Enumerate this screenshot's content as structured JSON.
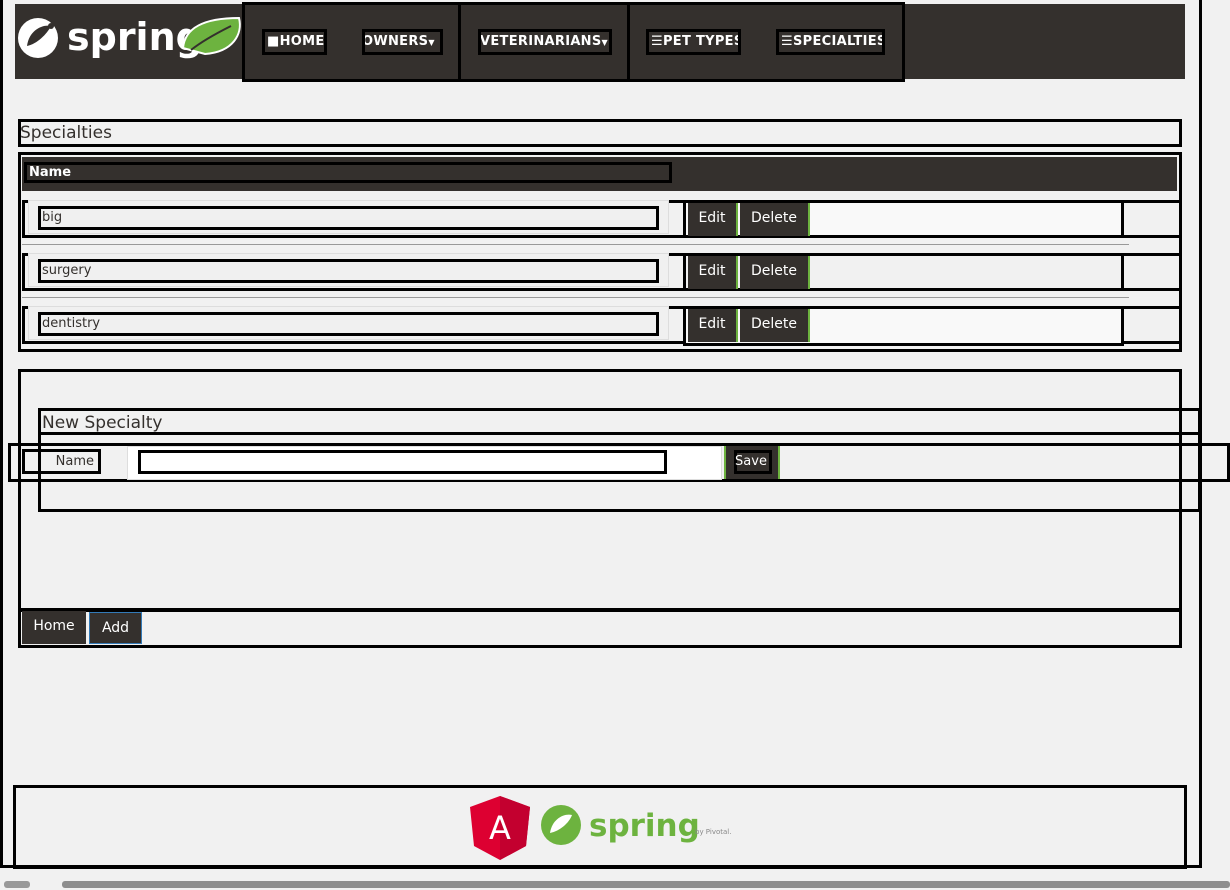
{
  "nav": {
    "logo_text": "spring",
    "items": [
      {
        "label": "HOME",
        "icon": "home-icon"
      },
      {
        "label": "OWNERS",
        "icon": "chevron-down-icon"
      },
      {
        "label": "VETERINARIANS",
        "icon": "chevron-down-icon"
      },
      {
        "label": "PET TYPES",
        "icon": "list-icon"
      },
      {
        "label": "SPECIALTIES",
        "icon": "list-icon"
      }
    ]
  },
  "specialties": {
    "title": "Specialties",
    "column_name": "Name",
    "rows": [
      {
        "name": "big",
        "edit": "Edit",
        "delete": "Delete"
      },
      {
        "name": "surgery",
        "edit": "Edit",
        "delete": "Delete"
      },
      {
        "name": "dentistry",
        "edit": "Edit",
        "delete": "Delete"
      }
    ]
  },
  "new_specialty": {
    "title": "New Specialty",
    "name_label": "Name",
    "name_value": "",
    "save_label": "Save"
  },
  "actions": {
    "home_label": "Home",
    "add_label": "Add"
  },
  "footer": {
    "angular_letter": "A",
    "spring_text": "spring",
    "pivotal_text": "by Pivotal."
  },
  "colors": {
    "brand_dark": "#34302d",
    "spring_green": "#6db33f",
    "angular_red": "#dd0031"
  }
}
